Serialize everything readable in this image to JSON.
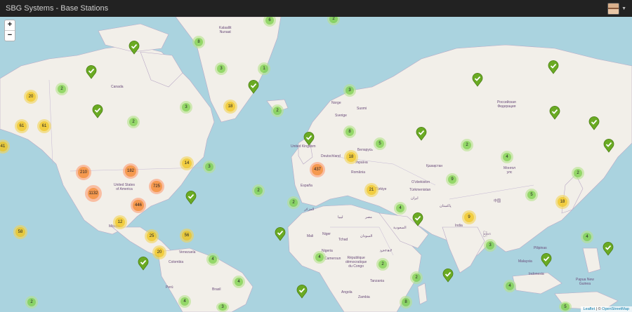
{
  "header": {
    "title": "SBG Systems - Base Stations"
  },
  "user": {
    "icon": "user-avatar-icon",
    "menu_icon": "caret-down-icon"
  },
  "zoom": {
    "in_label": "+",
    "out_label": "−"
  },
  "attribution": {
    "leaflet": "Leaflet",
    "separator": " | © ",
    "osm": "OpenStreetMap"
  },
  "colors": {
    "small": "#6ecc39",
    "medium": "#f0c20c",
    "large": "#f18017",
    "pin": "#6aaa23",
    "land": "#f2efe9",
    "water": "#aad3df"
  },
  "clusters": [
    {
      "n": "6"
    },
    {
      "n": "2"
    },
    {
      "n": "8"
    },
    {
      "n": "3"
    },
    {
      "n": "1"
    },
    {
      "n": "20"
    },
    {
      "n": "2"
    },
    {
      "n": "3"
    },
    {
      "n": "18"
    },
    {
      "n": "2"
    },
    {
      "n": "3"
    },
    {
      "n": "61"
    },
    {
      "n": "61"
    },
    {
      "n": "2"
    },
    {
      "n": "41"
    },
    {
      "n": "8"
    },
    {
      "n": "5"
    },
    {
      "n": "18"
    },
    {
      "n": "2"
    },
    {
      "n": "4"
    },
    {
      "n": "14"
    },
    {
      "n": "3"
    },
    {
      "n": "210"
    },
    {
      "n": "182"
    },
    {
      "n": "437"
    },
    {
      "n": "2"
    },
    {
      "n": "2"
    },
    {
      "n": "1132"
    },
    {
      "n": "725"
    },
    {
      "n": "21"
    },
    {
      "n": "9"
    },
    {
      "n": "5"
    },
    {
      "n": "2"
    },
    {
      "n": "446"
    },
    {
      "n": "18"
    },
    {
      "n": "4"
    },
    {
      "n": "9"
    },
    {
      "n": "12"
    },
    {
      "n": "58"
    },
    {
      "n": "25"
    },
    {
      "n": "56"
    },
    {
      "n": "3"
    },
    {
      "n": "4"
    },
    {
      "n": "20"
    },
    {
      "n": "4"
    },
    {
      "n": "4"
    },
    {
      "n": "2"
    },
    {
      "n": "4"
    },
    {
      "n": "2"
    },
    {
      "n": "4"
    },
    {
      "n": "2"
    },
    {
      "n": "4"
    },
    {
      "n": "3"
    },
    {
      "n": "8"
    },
    {
      "n": "5"
    }
  ],
  "labels": {
    "canada": "Canada",
    "kalaallit": "Kalaallit\nNunaat",
    "usa": "United States\nof America",
    "mexico": "México",
    "venezuela": "Venezuela",
    "colombia": "Colombia",
    "peru": "Perú",
    "brasil": "Brasil",
    "norge": "Norge",
    "sverige": "Sverige",
    "suomi": "Suomi",
    "uk": "United Kingdom",
    "deutschland": "Deutschland",
    "belarus": "Беларусь",
    "ukraina": "Україна",
    "romania": "România",
    "espana": "España",
    "turkiye": "Türkiye",
    "algerie": "الجزائر",
    "libya": "ليبيا",
    "egypt": "مصر",
    "mali": "Mali",
    "niger": "Niger",
    "tchad": "Tchad",
    "sudan": "السودان",
    "nigeria": "Nigeria",
    "ethiopia": "ኢትዮጵያ",
    "cameroun": "Cameroun",
    "congo": "République\ndémocratique\ndu Congo",
    "tanzania": "Tanzania",
    "angola": "Angola",
    "zambia": "Zambia",
    "saudi": "السعودية",
    "iran": "ایران",
    "kazakhstan": "Қазақстан",
    "uzbekistan": "Oʻzbekiston",
    "turkmenistan": "Türkmenistan",
    "pakistan": "پاکستان",
    "india": "India",
    "russia": "Российская\nФедерация",
    "mongolia": "Монгол\nулс",
    "china": "中国",
    "myanmar": "မြန်မာ",
    "philippines": "Pilipinas",
    "malaysia": "Malaysia",
    "indonesia": "Indonesia",
    "png": "Papua New\nGuinea",
    "deutschland2": "Deutschland"
  }
}
